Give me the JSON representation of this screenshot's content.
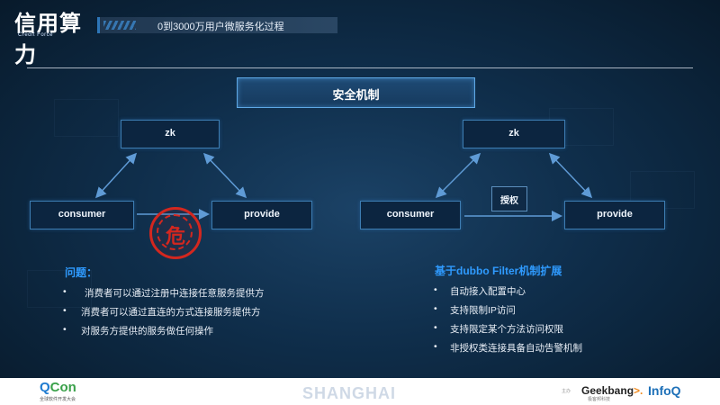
{
  "header": {
    "logo_text": "信用算力",
    "logo_subtext": "Credit Force",
    "title": "0到3000万用户微服务化过程"
  },
  "section_title": "安全机制",
  "left_diagram": {
    "top_node": "zk",
    "left_node": "consumer",
    "right_node": "provide",
    "stamp_char": "危"
  },
  "right_diagram": {
    "top_node": "zk",
    "left_node": "consumer",
    "right_node": "provide",
    "auth_label": "授权"
  },
  "problems": {
    "title": "问题：",
    "items": [
      "消费者可以通过注册中连接任意服务提供方",
      "消费者可以通过直连的方式连接服务提供方",
      "对服务方提供的服务做任何操作"
    ]
  },
  "solution": {
    "title": "基于dubbo Filter机制扩展",
    "items": [
      "自动接入配置中心",
      "支持限制IP访问",
      "支持限定某个方法访问权限",
      "非授权类连接具备自动告警机制"
    ]
  },
  "bullet": "•",
  "footer": {
    "qcon_q": "Q",
    "qcon_c": "Con",
    "qcon_sub": "全球软件开发大会",
    "city": "SHANGHAI",
    "sponsor_prefix": "主办",
    "geek": "Geekbang",
    "geek_x": ">.",
    "geek_sub": "极客邦科技",
    "infoq": "InfoQ"
  },
  "colors": {
    "accent_blue": "#2f9bff",
    "node_border": "#3d7db2",
    "arrow": "#5f9bd6",
    "stamp_red": "#d3271f"
  }
}
